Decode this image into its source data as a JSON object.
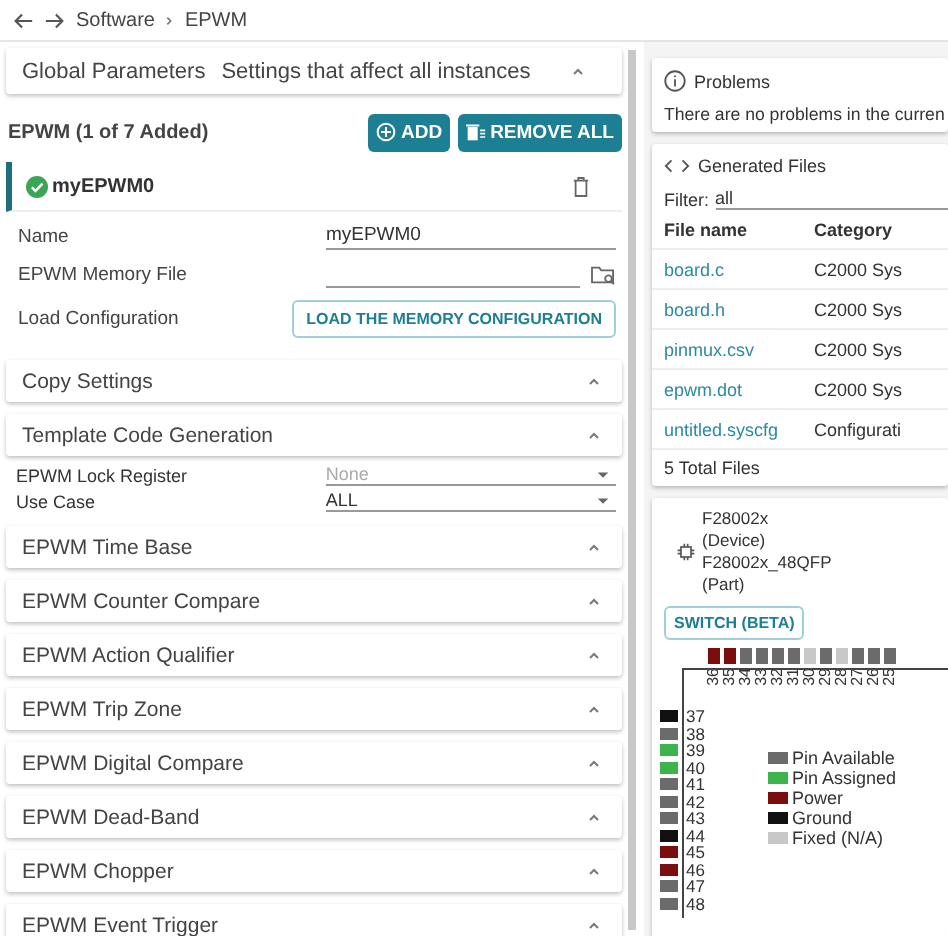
{
  "breadcrumb": [
    "Software",
    "EPWM"
  ],
  "global_parameters": {
    "title": "Global Parameters",
    "subtitle": "Settings that affect all instances"
  },
  "module": {
    "title": "EPWM (1 of 7 Added)",
    "buttons": [
      {
        "kind": "add",
        "label": "ADD"
      },
      {
        "kind": "remove",
        "label": "REMOVE ALL"
      }
    ]
  },
  "instance": {
    "name": "myEPWM0",
    "selected": true
  },
  "fields": [
    {
      "kind": "text",
      "label": "Name",
      "value": "myEPWM0"
    },
    {
      "kind": "file",
      "label": "EPWM Memory File"
    },
    {
      "kind": "button",
      "label": "Load Configuration",
      "button": "LOAD THE MEMORY CONFIGURATION"
    }
  ],
  "sections": [
    {
      "title": "Copy Settings"
    },
    {
      "title": "Template Code Generation",
      "fields": [
        {
          "label": "EPWM Lock Register",
          "value": "None",
          "disabled": true
        },
        {
          "label": "Use Case",
          "value": "ALL",
          "disabled": false
        }
      ]
    },
    {
      "title": "EPWM Time Base"
    },
    {
      "title": "EPWM Counter Compare"
    },
    {
      "title": "EPWM Action Qualifier"
    },
    {
      "title": "EPWM Trip Zone"
    },
    {
      "title": "EPWM Digital Compare"
    },
    {
      "title": "EPWM Dead-Band"
    },
    {
      "title": "EPWM Chopper"
    },
    {
      "title": "EPWM Event Trigger"
    }
  ],
  "problems": {
    "title": "Problems",
    "message": "There are no problems in the curren"
  },
  "generated_files": {
    "title": "Generated Files",
    "filter_label": "Filter:",
    "filter_value": "all",
    "columns": [
      "File name",
      "Category"
    ],
    "rows": [
      [
        "board.c",
        "C2000 Sys"
      ],
      [
        "board.h",
        "C2000 Sys"
      ],
      [
        "pinmux.csv",
        "C2000 Sys"
      ],
      [
        "epwm.dot",
        "C2000 Sys"
      ],
      [
        "untitled.syscfg",
        "Configurati"
      ]
    ],
    "footer": "5 Total Files"
  },
  "device": {
    "lines": [
      "F28002x",
      "(Device)",
      "F28002x_48QFP",
      "(Part)"
    ],
    "button": "SWITCH (BETA)"
  },
  "pinout": {
    "top_pins": [
      {
        "number": "36",
        "color": "#7a0d0d"
      },
      {
        "number": "35",
        "color": "#7a0d0d"
      },
      {
        "number": "34",
        "color": "#6b6b6b"
      },
      {
        "number": "33",
        "color": "#6b6b6b"
      },
      {
        "number": "32",
        "color": "#6b6b6b"
      },
      {
        "number": "31",
        "color": "#6b6b6b"
      },
      {
        "number": "30",
        "color": "#c8c8c8"
      },
      {
        "number": "29",
        "color": "#6b6b6b"
      },
      {
        "number": "28",
        "color": "#c8c8c8"
      },
      {
        "number": "27",
        "color": "#6b6b6b"
      },
      {
        "number": "26",
        "color": "#6b6b6b"
      },
      {
        "number": "25",
        "color": "#6b6b6b"
      }
    ],
    "left_pins": [
      {
        "number": "37",
        "color": "#111111"
      },
      {
        "number": "38",
        "color": "#6b6b6b"
      },
      {
        "number": "39",
        "color": "#3cb44b"
      },
      {
        "number": "40",
        "color": "#3cb44b"
      },
      {
        "number": "41",
        "color": "#6b6b6b"
      },
      {
        "number": "42",
        "color": "#6b6b6b"
      },
      {
        "number": "43",
        "color": "#6b6b6b"
      },
      {
        "number": "44",
        "color": "#111111"
      },
      {
        "number": "45",
        "color": "#7a0d0d"
      },
      {
        "number": "46",
        "color": "#7a0d0d"
      },
      {
        "number": "47",
        "color": "#6b6b6b"
      },
      {
        "number": "48",
        "color": "#6b6b6b"
      }
    ],
    "legend": [
      {
        "label": "Pin Available",
        "color": "#6b6b6b"
      },
      {
        "label": "Pin Assigned",
        "color": "#3cb44b"
      },
      {
        "label": "Power",
        "color": "#7a0d0d"
      },
      {
        "label": "Ground",
        "color": "#111111"
      },
      {
        "label": "Fixed (N/A)",
        "color": "#c8c8c8"
      }
    ]
  }
}
